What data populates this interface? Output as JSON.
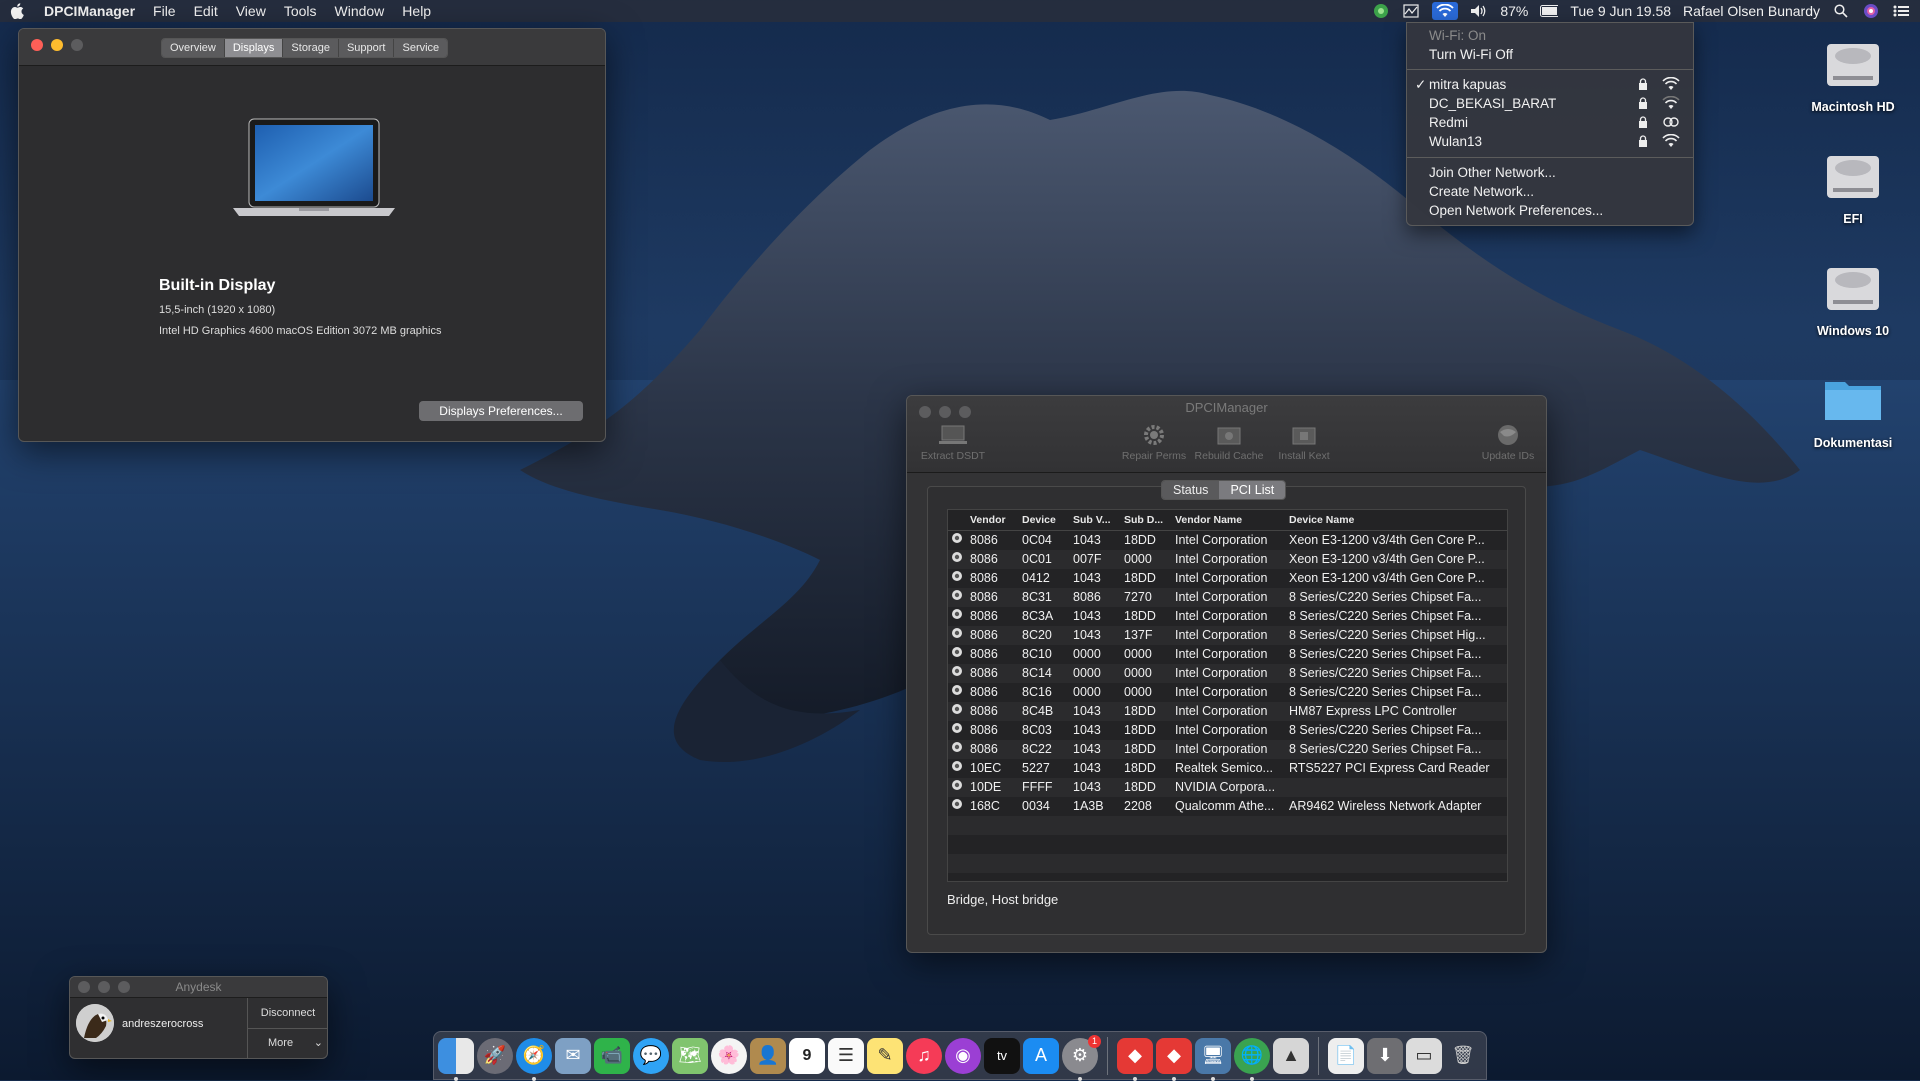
{
  "menubar": {
    "app_name": "DPCIManager",
    "menus": [
      "File",
      "Edit",
      "View",
      "Tools",
      "Window",
      "Help"
    ],
    "battery": "87%",
    "datetime": "Tue 9 Jun  19.58",
    "user": "Rafael Olsen Bunardy"
  },
  "about_window": {
    "tabs": [
      "Overview",
      "Displays",
      "Storage",
      "Support",
      "Service"
    ],
    "active_tab": "Displays",
    "display_title": "Built-in Display",
    "display_size": "15,5-inch (1920 x 1080)",
    "display_gpu": "Intel HD Graphics 4600 macOS Edition 3072 MB graphics",
    "pref_button": "Displays Preferences..."
  },
  "wifi_menu": {
    "status": "Wi-Fi: On",
    "toggle": "Turn Wi-Fi Off",
    "networks": [
      {
        "name": "mitra kapuas",
        "selected": true
      },
      {
        "name": "DC_BEKASI_BARAT",
        "selected": false
      },
      {
        "name": "Redmi",
        "selected": false
      },
      {
        "name": "Wulan13",
        "selected": false
      }
    ],
    "actions": [
      "Join Other Network...",
      "Create Network...",
      "Open Network Preferences..."
    ]
  },
  "desktop_icons": [
    "Macintosh HD",
    "EFI",
    "Windows 10",
    "Dokumentasi"
  ],
  "dpci": {
    "title": "DPCIManager",
    "toolbar": [
      "Extract DSDT",
      "Repair Perms",
      "Rebuild Cache",
      "Install Kext",
      "Update IDs"
    ],
    "segments": [
      "Status",
      "PCI List"
    ],
    "active_segment": "PCI List",
    "columns": [
      "Vendor",
      "Device",
      "Sub V...",
      "Sub D...",
      "Vendor Name",
      "Device Name"
    ],
    "rows": [
      [
        "8086",
        "0C04",
        "1043",
        "18DD",
        "Intel Corporation",
        "Xeon E3-1200 v3/4th Gen Core P..."
      ],
      [
        "8086",
        "0C01",
        "007F",
        "0000",
        "Intel Corporation",
        "Xeon E3-1200 v3/4th Gen Core P..."
      ],
      [
        "8086",
        "0412",
        "1043",
        "18DD",
        "Intel Corporation",
        "Xeon E3-1200 v3/4th Gen Core P..."
      ],
      [
        "8086",
        "8C31",
        "8086",
        "7270",
        "Intel Corporation",
        "8 Series/C220 Series Chipset Fa..."
      ],
      [
        "8086",
        "8C3A",
        "1043",
        "18DD",
        "Intel Corporation",
        "8 Series/C220 Series Chipset Fa..."
      ],
      [
        "8086",
        "8C20",
        "1043",
        "137F",
        "Intel Corporation",
        "8 Series/C220 Series Chipset Hig..."
      ],
      [
        "8086",
        "8C10",
        "0000",
        "0000",
        "Intel Corporation",
        "8 Series/C220 Series Chipset Fa..."
      ],
      [
        "8086",
        "8C14",
        "0000",
        "0000",
        "Intel Corporation",
        "8 Series/C220 Series Chipset Fa..."
      ],
      [
        "8086",
        "8C16",
        "0000",
        "0000",
        "Intel Corporation",
        "8 Series/C220 Series Chipset Fa..."
      ],
      [
        "8086",
        "8C4B",
        "1043",
        "18DD",
        "Intel Corporation",
        "HM87 Express LPC Controller"
      ],
      [
        "8086",
        "8C03",
        "1043",
        "18DD",
        "Intel Corporation",
        "8 Series/C220 Series Chipset Fa..."
      ],
      [
        "8086",
        "8C22",
        "1043",
        "18DD",
        "Intel Corporation",
        "8 Series/C220 Series Chipset Fa..."
      ],
      [
        "10EC",
        "5227",
        "1043",
        "18DD",
        "Realtek Semico...",
        "RTS5227 PCI Express Card Reader"
      ],
      [
        "10DE",
        "FFFF",
        "1043",
        "18DD",
        "NVIDIA Corpora...",
        ""
      ],
      [
        "168C",
        "0034",
        "1A3B",
        "2208",
        "Qualcomm Athe...",
        "AR9462 Wireless Network Adapter"
      ]
    ],
    "status_text": "Bridge, Host bridge"
  },
  "anydesk": {
    "title": "Anydesk",
    "username": "andreszerocross",
    "disconnect": "Disconnect",
    "more": "More"
  },
  "dock": {
    "calendar_day": "9",
    "badge": "1",
    "tv_label": "tv"
  }
}
